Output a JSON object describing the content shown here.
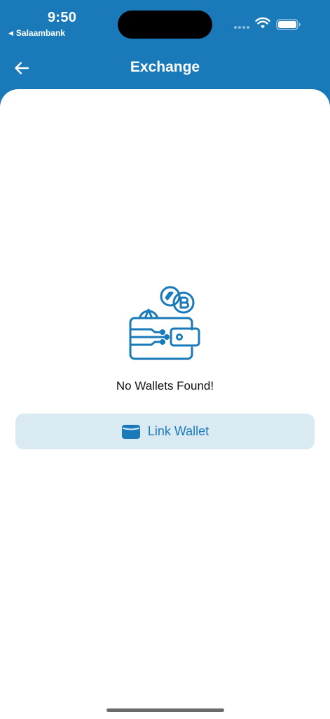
{
  "status_bar": {
    "time": "9:50",
    "back_app_label": "Salaambank"
  },
  "header": {
    "title": "Exchange",
    "back_icon": "arrow-left-icon"
  },
  "empty_state": {
    "illustration_icon": "crypto-wallet-icon",
    "message": "No Wallets Found!"
  },
  "actions": {
    "link_wallet_label": "Link Wallet",
    "link_wallet_icon": "wallet-icon"
  },
  "colors": {
    "brand": "#1a7ab9",
    "button_bg": "#d9eaf3",
    "background": "#ffffff"
  }
}
